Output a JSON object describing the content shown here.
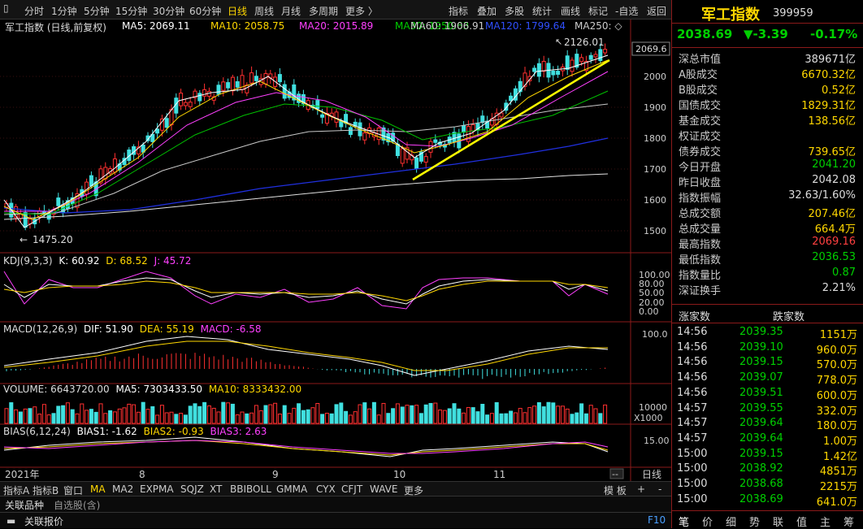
{
  "toolbar": {
    "periods": [
      "分时",
      "1分钟",
      "5分钟",
      "15分钟",
      "30分钟",
      "60分钟",
      "日线",
      "周线",
      "月线",
      "多周期",
      "更多 〉"
    ],
    "active": "日线",
    "tools": [
      "指标",
      "叠加",
      "多股",
      "统计",
      "画线",
      "标记",
      "-自选",
      "返回"
    ]
  },
  "info": {
    "title": "军工指数 (日线,前复权)",
    "ma5": "MA5: 2069.11",
    "ma10": "MA10: 2058.75",
    "ma20": "MA20: 2015.89",
    "ma30": "MA30: 1950.63",
    "ma60": "MA60: 1906.91",
    "ma120": "MA120: 1799.64",
    "ma250": "MA250: ◇"
  },
  "main_chart": {
    "high_label": "2126.01",
    "low_label": "1475.20",
    "price_tag": "2069.6",
    "axis_ticks": [
      "2000",
      "1900",
      "1800",
      "1700",
      "1600",
      "1500"
    ],
    "x_labels": [
      "2021年",
      "8",
      "9",
      "10",
      "11"
    ]
  },
  "kdj": {
    "label": "KDJ(9,3,3)",
    "k": "K: 60.92",
    "d": "D: 68.52",
    "j": "J: 45.72",
    "axis": [
      "100.00",
      "80.00",
      "50.00",
      "20.00",
      "0.00"
    ]
  },
  "macd": {
    "label": "MACD(12,26,9)",
    "dif": "DIF: 51.90",
    "dea": "DEA: 55.19",
    "macd": "MACD: -6.58",
    "axis": [
      "100.0"
    ]
  },
  "volume": {
    "label": "VOLUME: 6643720.00",
    "ma5": "MA5: 7303433.50",
    "ma10": "MA10: 8333432.00",
    "axis": [
      "10000",
      "X1000"
    ]
  },
  "bias": {
    "label": "BIAS(6,12,24)",
    "b1": "BIAS1: -1.62",
    "b2": "BIAS2: -0.93",
    "b3": "BIAS3: 2.63",
    "axis": [
      "15.00"
    ]
  },
  "bottom_tabs": [
    "指标A",
    "指标B",
    "窗口",
    "MA",
    "MA2",
    "EXPMA",
    "SQJZ",
    "XT",
    "BBIBOLL",
    "GMMA",
    "CYX",
    "CFJT",
    "WAVE",
    "更多"
  ],
  "bottom_right": [
    "模 板",
    "+",
    "-"
  ],
  "period_label": "日线",
  "related": {
    "tab1": "关联品种",
    "tab2": "自选股(含)",
    "report": "关联报价",
    "f10": "F10"
  },
  "quote": {
    "name": "军工指数",
    "code": "399959",
    "price": "2038.69",
    "change": "▼-3.39",
    "pct": "-0.17%",
    "rows": [
      {
        "label": "深总市值",
        "value": "389671亿",
        "color": "#ddd"
      },
      {
        "label": "A股成交",
        "value": "6670.32亿",
        "color": "#ffd700"
      },
      {
        "label": "B股成交",
        "value": "0.52亿",
        "color": "#ffd700"
      },
      {
        "label": "国债成交",
        "value": "1829.31亿",
        "color": "#ffd700"
      },
      {
        "label": "基金成交",
        "value": "138.56亿",
        "color": "#ffd700"
      },
      {
        "label": "权证成交",
        "value": "",
        "color": "#ffd700"
      },
      {
        "label": "债券成交",
        "value": "739.65亿",
        "color": "#ffd700"
      },
      {
        "label": "今日开盘",
        "value": "2041.20",
        "color": "#00d000"
      },
      {
        "label": "昨日收盘",
        "value": "2042.08",
        "color": "#ddd"
      },
      {
        "label": "指数振幅",
        "value": "32.63/1.60%",
        "color": "#ddd"
      },
      {
        "label": "总成交额",
        "value": "207.46亿",
        "color": "#ffd700"
      },
      {
        "label": "总成交量",
        "value": "664.4万",
        "color": "#ffd700"
      },
      {
        "label": "最高指数",
        "value": "2069.16",
        "color": "#ff4040"
      },
      {
        "label": "最低指数",
        "value": "2036.53",
        "color": "#00d000"
      },
      {
        "label": "指数量比",
        "value": "0.87",
        "color": "#00d000"
      },
      {
        "label": "深证换手",
        "value": "2.21%",
        "color": "#ddd"
      }
    ],
    "rise_label": "涨家数",
    "fall_label": "跌家数",
    "ticks": [
      {
        "time": "14:56",
        "price": "2039.35",
        "vol": "1151万"
      },
      {
        "time": "14:56",
        "price": "2039.10",
        "vol": "960.0万"
      },
      {
        "time": "14:56",
        "price": "2039.15",
        "vol": "570.0万"
      },
      {
        "time": "14:56",
        "price": "2039.07",
        "vol": "778.0万"
      },
      {
        "time": "14:56",
        "price": "2039.51",
        "vol": "600.0万"
      },
      {
        "time": "14:57",
        "price": "2039.55",
        "vol": "332.0万"
      },
      {
        "time": "14:57",
        "price": "2039.64",
        "vol": "180.0万"
      },
      {
        "time": "14:57",
        "price": "2039.64",
        "vol": "1.00万"
      },
      {
        "time": "15:00",
        "price": "2039.15",
        "vol": "1.42亿"
      },
      {
        "time": "15:00",
        "price": "2038.92",
        "vol": "4851万"
      },
      {
        "time": "15:00",
        "price": "2038.68",
        "vol": "2215万"
      },
      {
        "time": "15:00",
        "price": "2038.69",
        "vol": "641.0万"
      }
    ],
    "footer_tabs": [
      "笔",
      "价",
      "细",
      "势",
      "联",
      "值",
      "主",
      "筹"
    ]
  }
}
